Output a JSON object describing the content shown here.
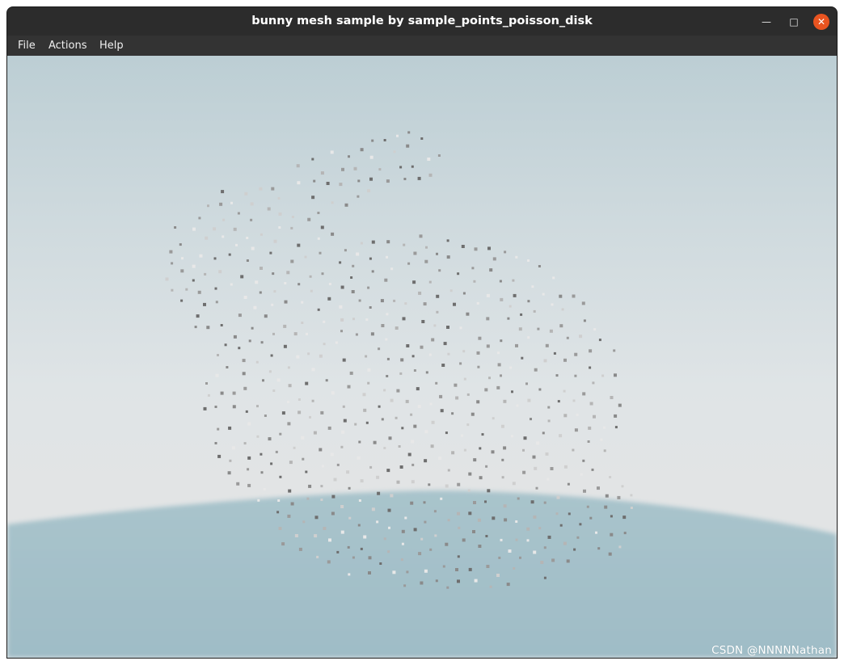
{
  "window": {
    "title": "bunny mesh sample by sample_points_poisson_disk",
    "controls": {
      "minimize_icon": "minimize-icon",
      "maximize_icon": "maximize-icon",
      "close_icon": "close-icon",
      "close_color": "#e95420"
    }
  },
  "menubar": {
    "items": [
      {
        "label": "File"
      },
      {
        "label": "Actions"
      },
      {
        "label": "Help"
      }
    ]
  },
  "scene": {
    "sky_color_top": "#bcced4",
    "sky_color_horizon": "#e2e4e5",
    "ground_color": "#a3bfc8",
    "point_cloud_colors": [
      "#9a9a9a",
      "#8a8a8a",
      "#b5b5b5",
      "#cfcfcf",
      "#6e6e6e",
      "#e8e8e8"
    ]
  },
  "watermark": "CSDN @NNNNNathan"
}
